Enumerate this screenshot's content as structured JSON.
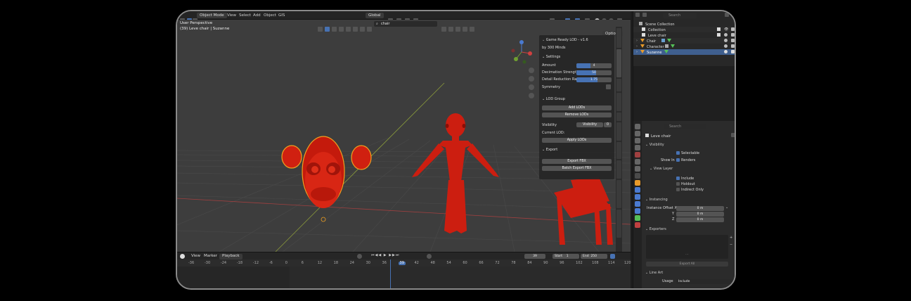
{
  "topbar": {
    "mode": "Object Mode",
    "menus": [
      "View",
      "Select",
      "Add",
      "Object",
      "GIS"
    ],
    "orientation": "Global",
    "options": "Options"
  },
  "search": {
    "value": "chair"
  },
  "viewport": {
    "perspective": "User Perspective",
    "object_info": "(39) Leve chair | Suzanne"
  },
  "addon": {
    "title": "Game Ready LOD - v1.6",
    "author": "by 300 Minds",
    "settings_header": "Settings",
    "amount_label": "Amount",
    "amount_value": "4",
    "amount_fraction": 0.4,
    "decimation_label": "Decimation Strength",
    "decimation_value": "50",
    "decimation_fraction": 0.55,
    "detail_label": "Detail Reduction Rate",
    "detail_value": "1.75",
    "detail_fraction": 0.6,
    "symmetry_label": "Symmetry",
    "lod_group_header": "LOD Group",
    "add_lods": "Add LODs",
    "remove_lods": "Remove LODs",
    "visibility_label": "Visibility",
    "visibility_value": "Visibility",
    "visibility_count": "0",
    "current_lod_label": "Current LOD:",
    "apply_lods": "Apply LODs",
    "export_header": "Export",
    "export_fbx": "Export FBX",
    "batch_export_fbx": "Batch Export FBX"
  },
  "side_tabs": [
    "Animation",
    "Game Ready LOD",
    "Create",
    "BlenderKit",
    "Edit",
    "BAGAPIE",
    "Sketchfab",
    "Web Search",
    "Tool",
    "Item"
  ],
  "timeline": {
    "menus": [
      "View",
      "Marker",
      "Playback"
    ],
    "current_frame": "39",
    "start_label": "Start",
    "start_value": "1",
    "end_label": "End",
    "end_value": "250",
    "ruler": [
      "-36",
      "-30",
      "-24",
      "-18",
      "-12",
      "-6",
      "0",
      "6",
      "12",
      "18",
      "24",
      "30",
      "36",
      "39",
      "42",
      "48",
      "54",
      "60",
      "66",
      "72",
      "78",
      "84",
      "90",
      "96",
      "102",
      "108",
      "114",
      "120"
    ]
  },
  "outliner": {
    "search_placeholder": "Search",
    "items": [
      {
        "label": "Scene Collection"
      },
      {
        "label": "Collection"
      },
      {
        "label": "Leve chair"
      },
      {
        "label": "Chair"
      },
      {
        "label": "Character"
      },
      {
        "label": "Suzanne"
      }
    ]
  },
  "properties": {
    "search_placeholder": "Search",
    "object_name": "Leve chair",
    "visibility_header": "Visibility",
    "selectable": "Selectable",
    "show_in_label": "Show In",
    "renders": "Renders",
    "view_layer_header": "View Layer",
    "include": "Include",
    "holdout": "Holdout",
    "indirect_only": "Indirect Only",
    "instancing_header": "Instancing",
    "offset_x_label": "Instance Offset X",
    "offset_x": "0 m",
    "y_label": "Y",
    "offset_y": "0 m",
    "z_label": "Z",
    "offset_z": "0 m",
    "exporters_header": "Exporters",
    "export_all": "Export All",
    "line_art_header": "Line Art",
    "usage_label": "Usage",
    "usage_value": "Include"
  },
  "colors": {
    "accent": "#4772b3",
    "model_red": "#d41e10",
    "viewport_bg": "#3d3d3d",
    "selection_outline": "#f0a020"
  }
}
